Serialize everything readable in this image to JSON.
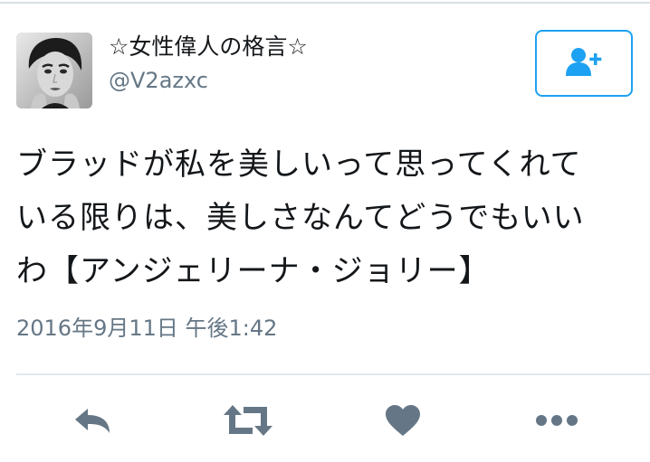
{
  "tweet": {
    "display_name": "☆女性偉人の格言☆",
    "handle": "@V2azxc",
    "text": "ブラッドが私を美しいって思ってくれて\nいる限りは、美しさなんてどうでもいい\nわ【アンジェリーナ・ジョリー】",
    "timestamp": "2016年9月11日 午後1:42"
  },
  "actions": {
    "follow_icon": "follow-user-icon",
    "reply_icon": "reply-icon",
    "retweet_icon": "retweet-icon",
    "like_icon": "heart-icon",
    "more_icon": "more-dots-icon"
  },
  "colors": {
    "accent": "#1da1f2",
    "icon_gray": "#657786",
    "text": "#14171a",
    "divider": "#e1e8ed"
  }
}
